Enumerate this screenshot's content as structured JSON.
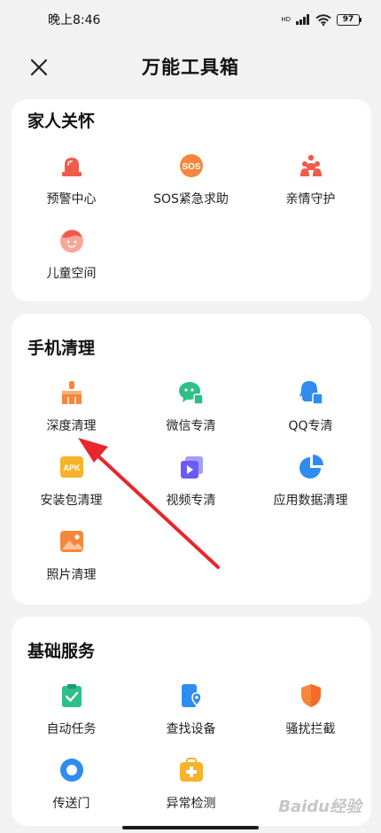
{
  "status": {
    "time": "晚上8:46",
    "signal_label": "HD",
    "battery": "97"
  },
  "header": {
    "title": "万能工具箱"
  },
  "sections": [
    {
      "title": "家人关怀",
      "items": [
        {
          "label": "预警中心",
          "icon": "alarm-light-icon"
        },
        {
          "label": "SOS紧急求助",
          "icon": "sos-icon"
        },
        {
          "label": "亲情守护",
          "icon": "family-icon"
        },
        {
          "label": "儿童空间",
          "icon": "child-face-icon"
        }
      ]
    },
    {
      "title": "手机清理",
      "items": [
        {
          "label": "深度清理",
          "icon": "broom-icon"
        },
        {
          "label": "微信专清",
          "icon": "wechat-icon"
        },
        {
          "label": "QQ专清",
          "icon": "qq-icon"
        },
        {
          "label": "安装包清理",
          "icon": "apk-icon",
          "icon_text": "APK"
        },
        {
          "label": "视频专清",
          "icon": "video-icon"
        },
        {
          "label": "应用数据清理",
          "icon": "pie-chart-icon"
        },
        {
          "label": "照片清理",
          "icon": "photo-icon"
        }
      ]
    },
    {
      "title": "基础服务",
      "items": [
        {
          "label": "自动任务",
          "icon": "clipboard-check-icon"
        },
        {
          "label": "查找设备",
          "icon": "find-device-icon"
        },
        {
          "label": "骚扰拦截",
          "icon": "shield-icon"
        },
        {
          "label": "传送门",
          "icon": "portal-ring-icon"
        },
        {
          "label": "异常检测",
          "icon": "first-aid-kit-icon"
        }
      ]
    }
  ],
  "colors": {
    "red": "#f25a4a",
    "orange": "#f5873c",
    "green": "#2fbf8a",
    "blue": "#2f8cf0",
    "purple": "#6a5cf2",
    "yellow": "#f7b32a",
    "arrow": "#e8262b"
  },
  "watermark": "Baidu经验"
}
